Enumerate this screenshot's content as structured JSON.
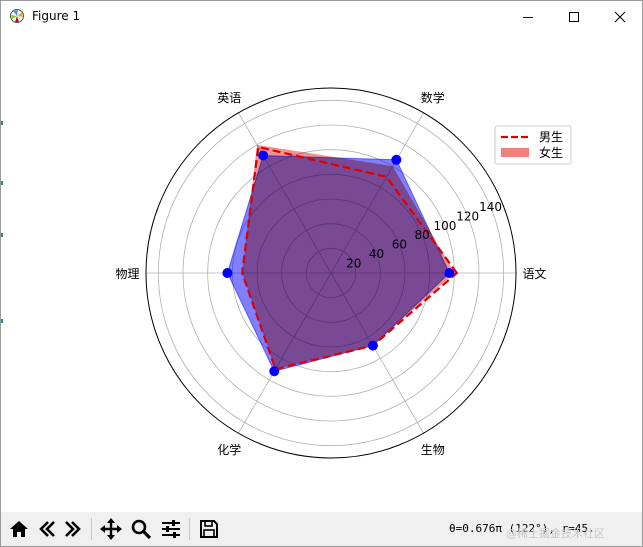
{
  "window": {
    "title": "Figure 1"
  },
  "toolbar": {
    "buttons": [
      "home-icon",
      "back-icon",
      "forward-icon",
      "pan-icon",
      "zoom-icon",
      "configure-icon",
      "save-icon"
    ],
    "status": "θ=0.676π (122°), r=45."
  },
  "watermark": "@稀土掘金技术社区",
  "chart_data": {
    "type": "radar",
    "categories": [
      "语文",
      "数学",
      "英语",
      "物理",
      "化学",
      "生物"
    ],
    "radial_ticks": [
      20,
      40,
      60,
      80,
      100,
      120,
      140
    ],
    "rlim": [
      0,
      150
    ],
    "grid": true,
    "legend_position": "top-right",
    "series": [
      {
        "name": "男生",
        "style": "dashed-line",
        "color": "#dd0000",
        "values": [
          102,
          90,
          118,
          72,
          90,
          68
        ]
      },
      {
        "name": "女生",
        "style": "filled",
        "color": "#f08080",
        "values": [
          100,
          100,
          120,
          72,
          90,
          68
        ]
      },
      {
        "name": "",
        "style": "filled-points",
        "color": "#0000ff",
        "values": [
          96,
          106,
          110,
          84,
          92,
          68
        ]
      }
    ]
  }
}
